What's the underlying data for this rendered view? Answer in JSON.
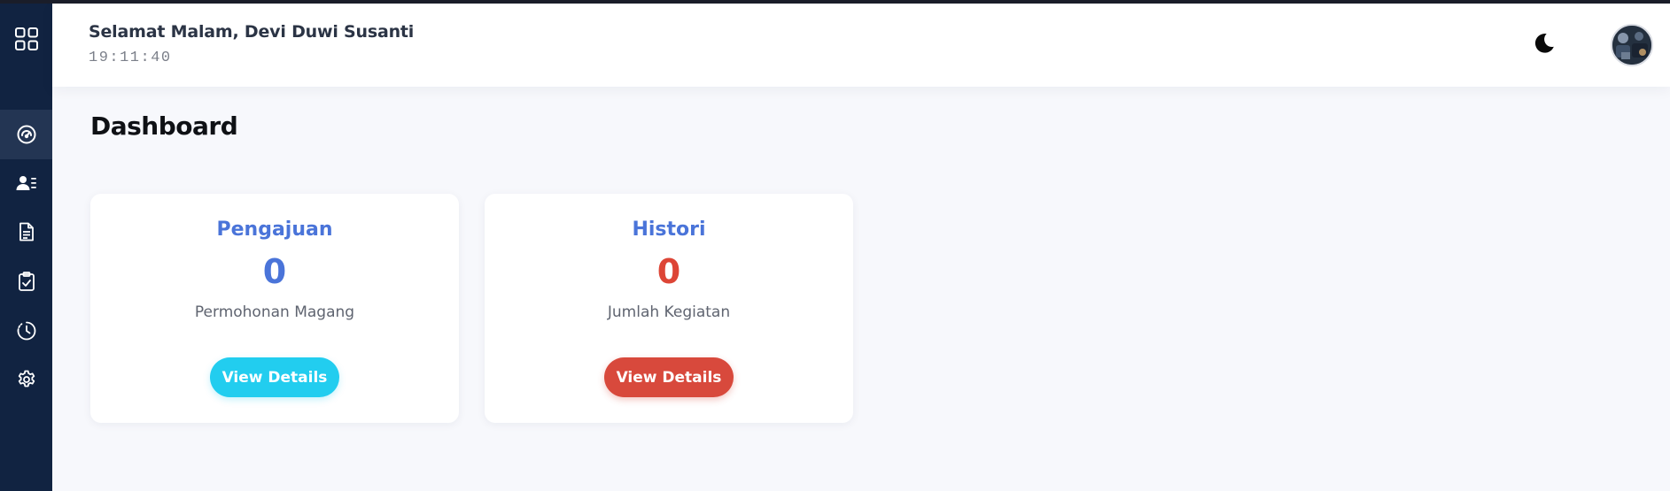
{
  "header": {
    "greeting": "Selamat Malam, Devi Duwi Susanti",
    "clock": "19:11:40"
  },
  "main": {
    "title": "Dashboard",
    "cards": [
      {
        "title": "Pengajuan",
        "value": "0",
        "subtitle": "Permohonan Magang",
        "button_label": "View Details",
        "accent_color": "#4a74d9",
        "value_color": "#4a74d9",
        "button_color": "#22cdef"
      },
      {
        "title": "Histori",
        "value": "0",
        "subtitle": "Jumlah Kegiatan",
        "button_label": "View Details",
        "accent_color": "#4a74d9",
        "value_color": "#dd4536",
        "button_color": "#d8493c"
      }
    ]
  },
  "sidebar": {
    "items": [
      {
        "icon": "grid-menu-icon"
      },
      {
        "icon": "dashboard-gauge-icon",
        "active": true
      },
      {
        "icon": "user-list-icon"
      },
      {
        "icon": "document-icon"
      },
      {
        "icon": "clipboard-check-icon"
      },
      {
        "icon": "clock-history-icon"
      },
      {
        "icon": "gear-icon"
      }
    ]
  },
  "colors": {
    "sidebar_bg": "#112341",
    "sidebar_active": "#233553",
    "page_bg": "#f7f8fc"
  }
}
